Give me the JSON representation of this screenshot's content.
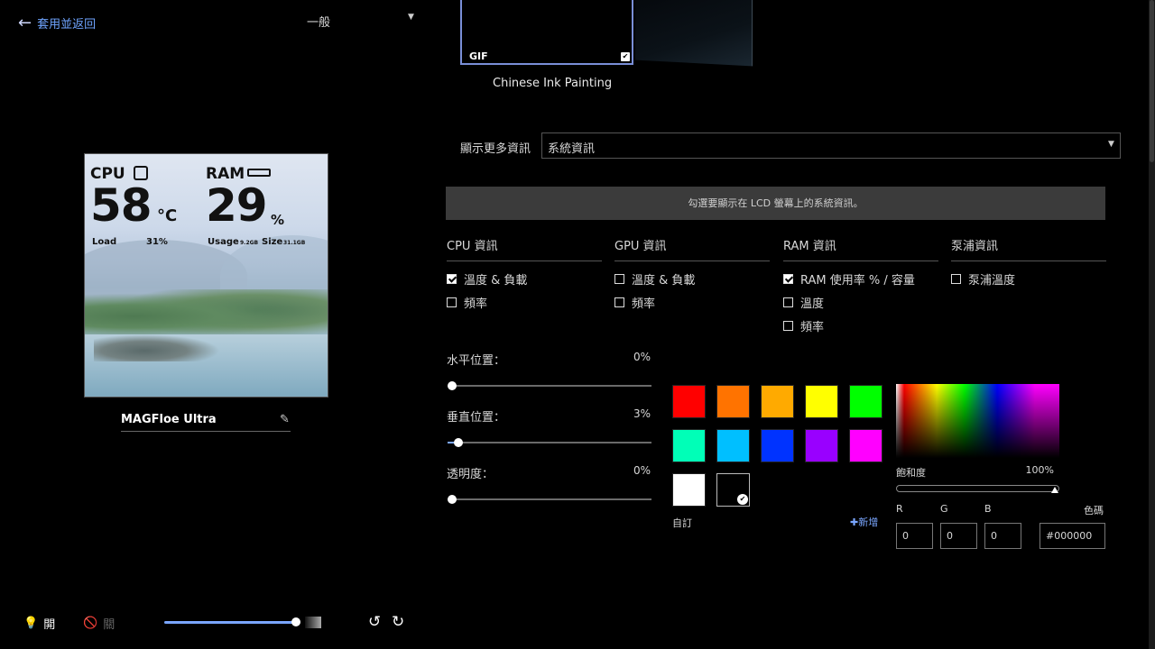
{
  "header": {
    "back_label": "套用並返回",
    "mode_value": "一般"
  },
  "preview": {
    "cpu_label": "CPU",
    "cpu_temp": "58",
    "cpu_unit": "°C",
    "ram_label": "RAM",
    "ram_value": "29",
    "ram_unit": "%",
    "load_label": "Load",
    "load_value": "31%",
    "usage_label": "Usage",
    "usage_value": "9.2GB",
    "size_label": "Size",
    "size_value": "31.1GB"
  },
  "device": {
    "name": "MAGFloe Ultra"
  },
  "bottom_bar": {
    "on_label": "開",
    "off_label": "關",
    "brightness_pct": 100
  },
  "theme": {
    "badge": "GIF",
    "title": "Chinese Ink Painting"
  },
  "more_info": {
    "label": "顯示更多資訊",
    "value": "系統資訊"
  },
  "banner": "勾選要顯示在 LCD 螢幕上的系統資訊。",
  "categories": [
    {
      "title": "CPU 資訊",
      "options": [
        {
          "label": "溫度 & 負載",
          "checked": true
        },
        {
          "label": "頻率",
          "checked": false
        }
      ]
    },
    {
      "title": "GPU 資訊",
      "options": [
        {
          "label": "溫度 & 負載",
          "checked": false
        },
        {
          "label": "頻率",
          "checked": false
        }
      ]
    },
    {
      "title": "RAM 資訊",
      "options": [
        {
          "label": "RAM 使用率 % / 容量",
          "checked": true
        },
        {
          "label": "溫度",
          "checked": false
        },
        {
          "label": "頻率",
          "checked": false
        }
      ]
    },
    {
      "title": "泵浦資訊",
      "options": [
        {
          "label": "泵浦溫度",
          "checked": false
        }
      ]
    }
  ],
  "sliders": [
    {
      "label": "水平位置：",
      "value": "0%",
      "pct": 0
    },
    {
      "label": "垂直位置：",
      "value": "3%",
      "pct": 3
    },
    {
      "label": "透明度：",
      "value": "0%",
      "pct": 0
    }
  ],
  "swatches": [
    "#ff0000",
    "#ff7300",
    "#ffaa00",
    "#ffff00",
    "#00ff00",
    "#00ffb7",
    "#00bfff",
    "#0033ff",
    "#9900ff",
    "#ff00ff",
    "#ffffff",
    "#000000"
  ],
  "selected_swatch": "#000000",
  "custom_label": "自訂",
  "add_label": "新增",
  "picker": {
    "saturation_label": "飽和度",
    "saturation_value": "100%",
    "r_label": "R",
    "g_label": "G",
    "b_label": "B",
    "r": "0",
    "g": "0",
    "b": "0",
    "hex_label": "色碼",
    "hex": "#000000"
  }
}
